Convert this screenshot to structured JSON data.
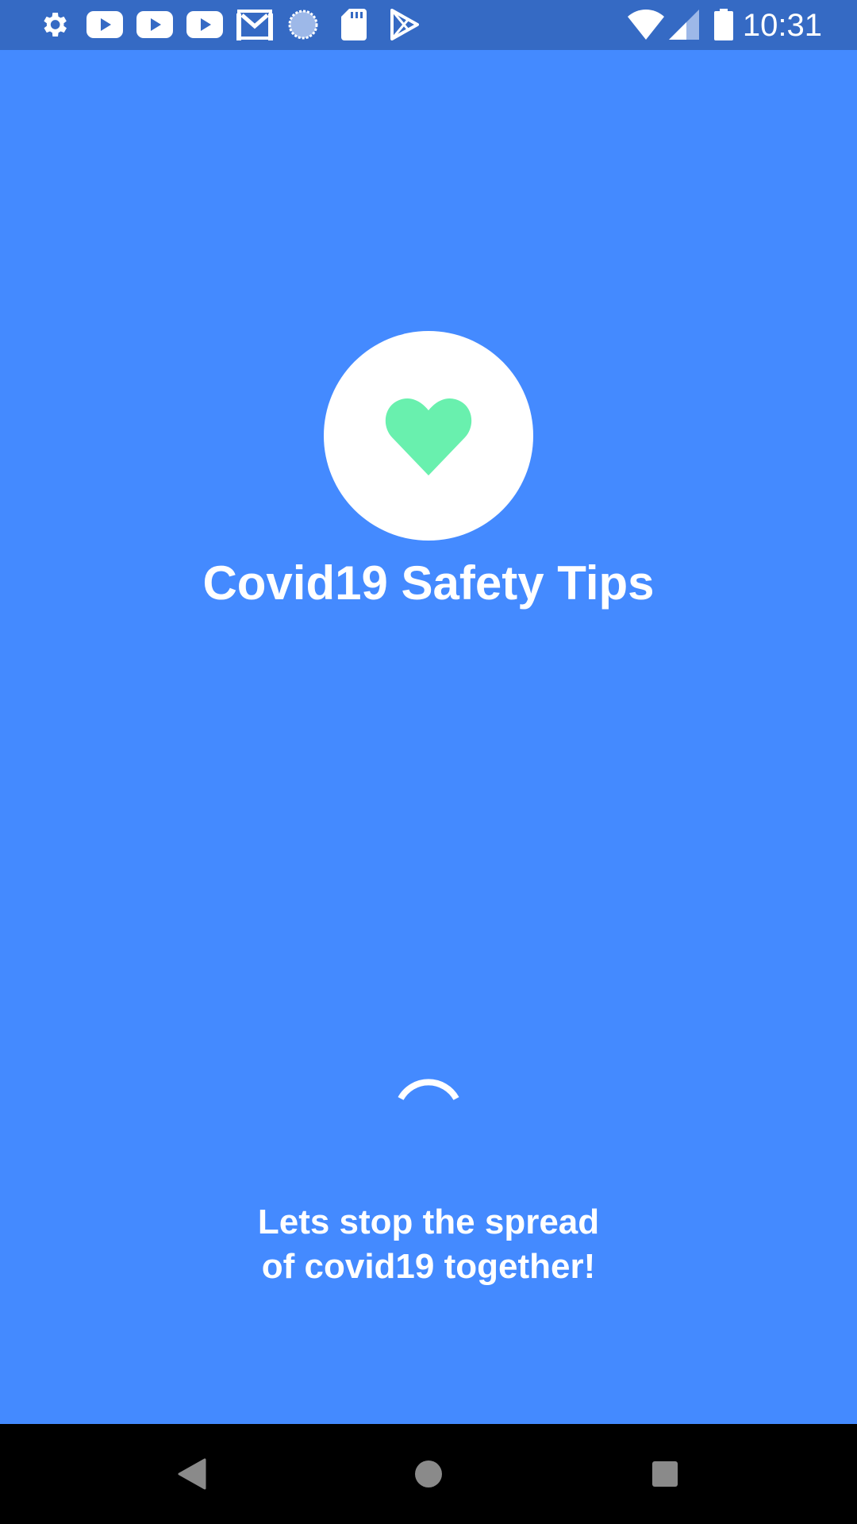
{
  "status_bar": {
    "time": "10:31",
    "notification_icons": [
      "settings-icon",
      "youtube-icon",
      "youtube-icon",
      "youtube-icon",
      "gmail-icon",
      "sync-icon",
      "sd-card-icon",
      "play-store-icon"
    ],
    "system_icons": [
      "wifi-icon",
      "signal-icon",
      "battery-icon"
    ]
  },
  "splash": {
    "logo_icon": "heart-icon",
    "title": "Covid19 Safety Tips",
    "tagline_line1": "Lets stop the spread",
    "tagline_line2": "of covid19 together!"
  },
  "colors": {
    "background": "#448AFF",
    "status_bar": "#356AC4",
    "heart": "#69F0AE",
    "nav_bar": "#000000"
  },
  "navigation": {
    "buttons": [
      "back-icon",
      "home-icon",
      "recents-icon"
    ]
  }
}
